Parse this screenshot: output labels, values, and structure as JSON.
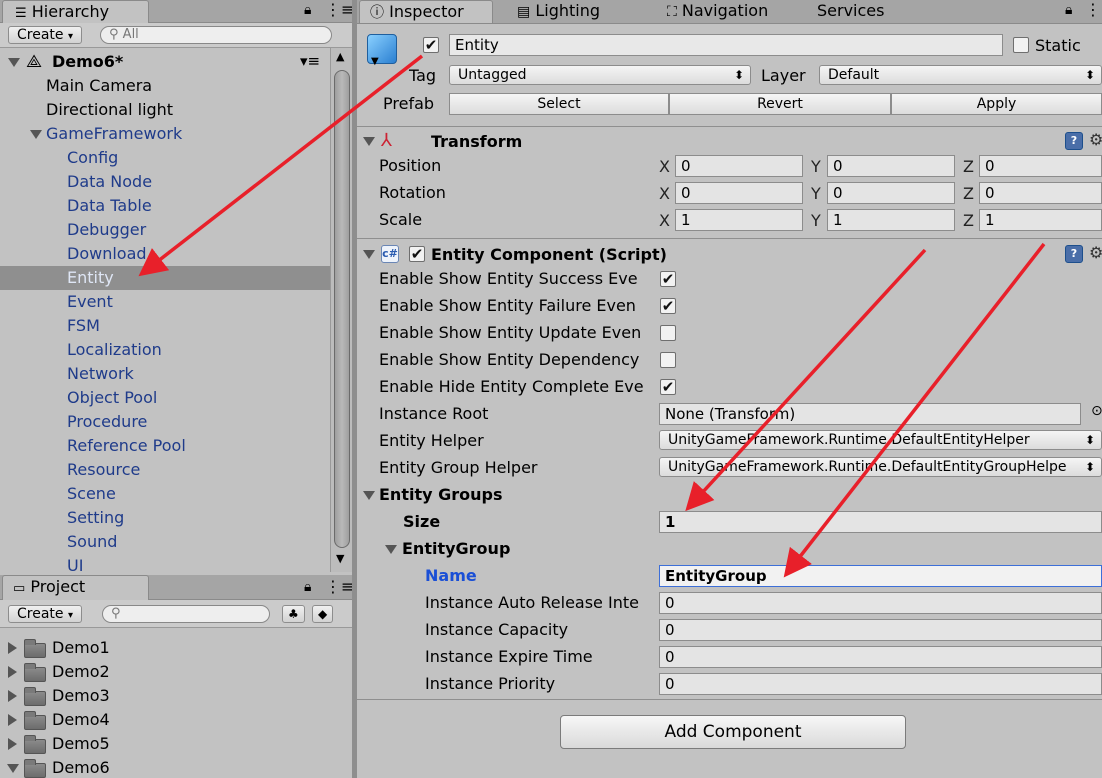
{
  "hierarchy": {
    "tab_label": "Hierarchy",
    "tab_icon": "list-icon",
    "create_label": "Create",
    "search_placeholder": "All",
    "scene_name": "Demo6*",
    "items": [
      {
        "label": "Main Camera"
      },
      {
        "label": "Directional light"
      },
      {
        "label": "GameFramework"
      },
      {
        "label": "Config"
      },
      {
        "label": "Data Node"
      },
      {
        "label": "Data Table"
      },
      {
        "label": "Debugger"
      },
      {
        "label": "Download"
      },
      {
        "label": "Entity"
      },
      {
        "label": "Event"
      },
      {
        "label": "FSM"
      },
      {
        "label": "Localization"
      },
      {
        "label": "Network"
      },
      {
        "label": "Object Pool"
      },
      {
        "label": "Procedure"
      },
      {
        "label": "Reference Pool"
      },
      {
        "label": "Resource"
      },
      {
        "label": "Scene"
      },
      {
        "label": "Setting"
      },
      {
        "label": "Sound"
      },
      {
        "label": "UI"
      }
    ]
  },
  "project": {
    "tab_label": "Project",
    "create_label": "Create",
    "folders": [
      {
        "label": "Demo1"
      },
      {
        "label": "Demo2"
      },
      {
        "label": "Demo3"
      },
      {
        "label": "Demo4"
      },
      {
        "label": "Demo5"
      },
      {
        "label": "Demo6"
      }
    ]
  },
  "tabs": {
    "inspector": "Inspector",
    "lighting": "Lighting",
    "navigation": "Navigation",
    "services": "Services"
  },
  "inspector": {
    "object_name": "Entity",
    "static_label": "Static",
    "tag_label": "Tag",
    "tag_value": "Untagged",
    "layer_label": "Layer",
    "layer_value": "Default",
    "prefab_label": "Prefab",
    "prefab_select": "Select",
    "prefab_revert": "Revert",
    "prefab_apply": "Apply",
    "transform": {
      "title": "Transform",
      "position_label": "Position",
      "rotation_label": "Rotation",
      "scale_label": "Scale",
      "x": "X",
      "y": "Y",
      "z": "Z",
      "position": [
        "0",
        "0",
        "0"
      ],
      "rotation": [
        "0",
        "0",
        "0"
      ],
      "scale": [
        "1",
        "1",
        "1"
      ]
    },
    "entity_component": {
      "title": "Entity Component (Script)",
      "toggles": [
        {
          "label": "Enable Show Entity Success Eve",
          "checked": true
        },
        {
          "label": "Enable Show Entity Failure Even",
          "checked": true
        },
        {
          "label": "Enable Show Entity Update Even",
          "checked": false
        },
        {
          "label": "Enable Show Entity Dependency",
          "checked": false
        },
        {
          "label": "Enable Hide Entity Complete Eve",
          "checked": true
        }
      ],
      "instance_root_label": "Instance Root",
      "instance_root_value": "None (Transform)",
      "entity_helper_label": "Entity Helper",
      "entity_helper_value": "UnityGameFramework.Runtime.DefaultEntityHelper",
      "entity_group_helper_label": "Entity Group Helper",
      "entity_group_helper_value": "UnityGameFramework.Runtime.DefaultEntityGroupHelpe",
      "entity_groups_label": "Entity Groups",
      "size_label": "Size",
      "size_value": "1",
      "group_label": "EntityGroup",
      "name_label": "Name",
      "name_value": "EntityGroup",
      "auto_release_label": "Instance Auto Release Inte",
      "auto_release_value": "0",
      "capacity_label": "Instance Capacity",
      "capacity_value": "0",
      "expire_label": "Instance Expire Time",
      "expire_value": "0",
      "priority_label": "Instance Priority",
      "priority_value": "0"
    },
    "add_component": "Add Component"
  },
  "colors": {
    "annotation_arrow": "#e8202a",
    "hierarchy_blue_text": "#1f3b8a",
    "selection_row": "#8f8f8f",
    "name_label_blue": "#1a4fd6"
  }
}
